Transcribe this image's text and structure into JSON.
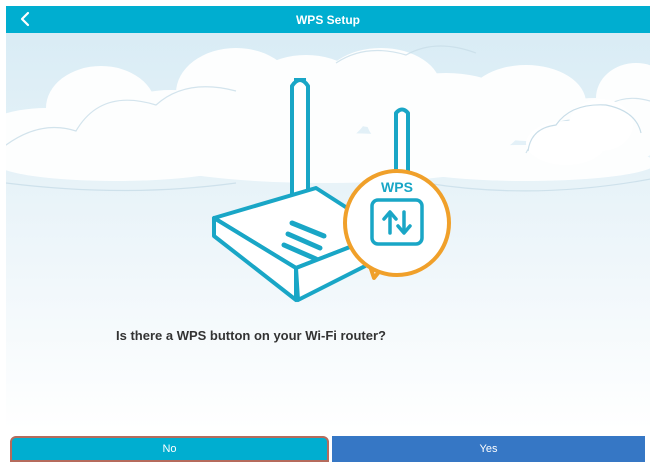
{
  "header": {
    "title": "WPS Setup",
    "back_icon": "chevron-left-icon"
  },
  "illustration": {
    "badge_label": "WPS",
    "badge_icon": "refresh-arrows-icon",
    "device_icon": "wifi-router-icon"
  },
  "main": {
    "question": "Is there a WPS button on your Wi-Fi router?"
  },
  "actions": {
    "no_label": "No",
    "yes_label": "Yes"
  },
  "colors": {
    "header": "#00aed0",
    "accent_teal": "#19a6c6",
    "badge_orange": "#f0a02a",
    "button_yes": "#3677c5"
  }
}
